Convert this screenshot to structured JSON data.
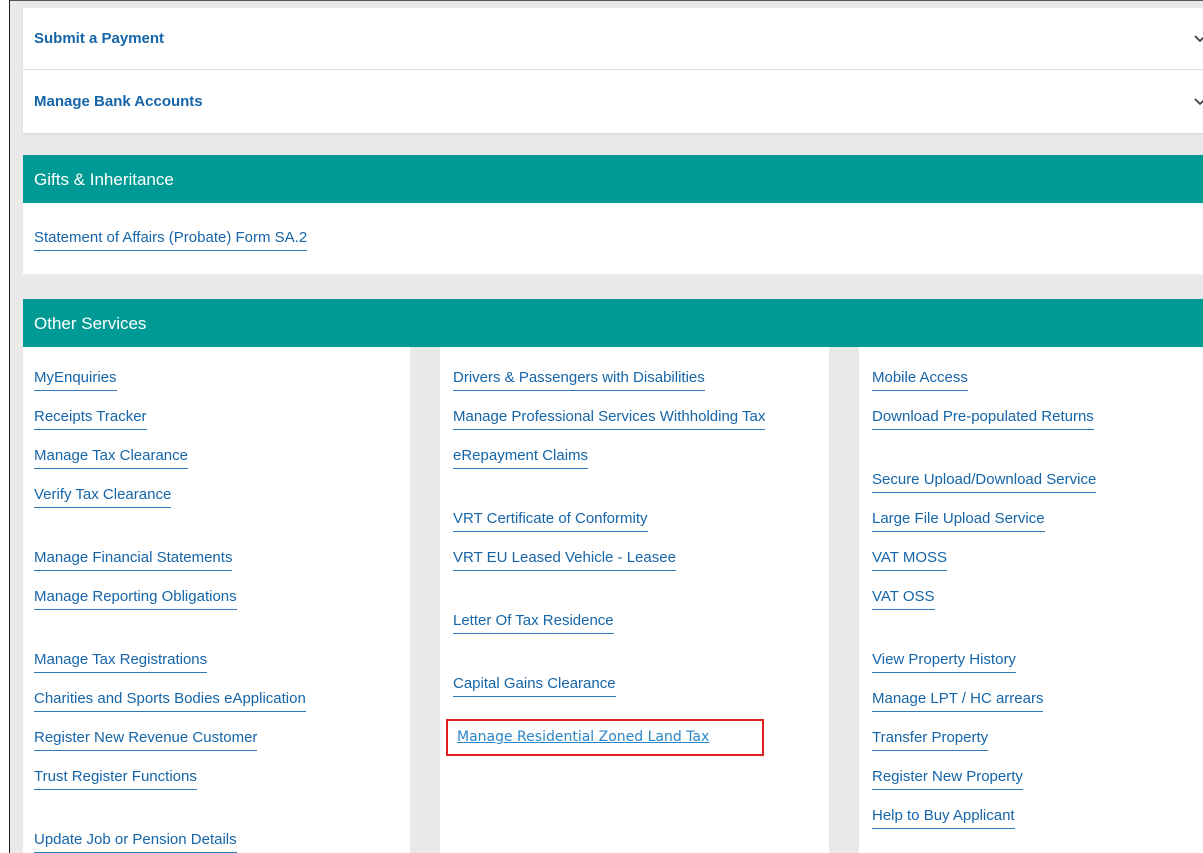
{
  "accordion": {
    "items": [
      {
        "label": "Submit a Payment"
      },
      {
        "label": "Manage Bank Accounts"
      }
    ]
  },
  "gifts": {
    "title": "Gifts & Inheritance",
    "links": [
      "Statement of Affairs (Probate) Form SA.2"
    ]
  },
  "other": {
    "title": "Other Services",
    "col1": [
      "MyEnquiries",
      "Receipts Tracker",
      "Manage Tax Clearance",
      "Verify Tax Clearance",
      "Manage Financial Statements",
      "Manage Reporting Obligations",
      "Manage Tax Registrations",
      "Charities and Sports Bodies eApplication",
      "Register New Revenue Customer",
      "Trust Register Functions",
      "Update Job or Pension Details"
    ],
    "col2": [
      "Drivers & Passengers with Disabilities",
      "Manage Professional Services Withholding Tax",
      "eRepayment Claims",
      "VRT Certificate of Conformity",
      "VRT EU Leased Vehicle - Leasee",
      "Letter Of Tax Residence",
      "Capital Gains Clearance",
      "Manage Residential Zoned Land Tax"
    ],
    "col3": [
      "Mobile Access",
      "Download Pre-populated Returns",
      "Secure Upload/Download Service",
      "Large File Upload Service",
      "VAT MOSS",
      "VAT OSS",
      "View Property History",
      "Manage LPT / HC arrears",
      "Transfer Property",
      "Register New Property",
      "Help to Buy Applicant"
    ]
  },
  "colors": {
    "teal_header": "#009a95",
    "link_blue": "#1565a8",
    "highlight_red": "#e02020",
    "page_bg": "#e9e9e9"
  }
}
